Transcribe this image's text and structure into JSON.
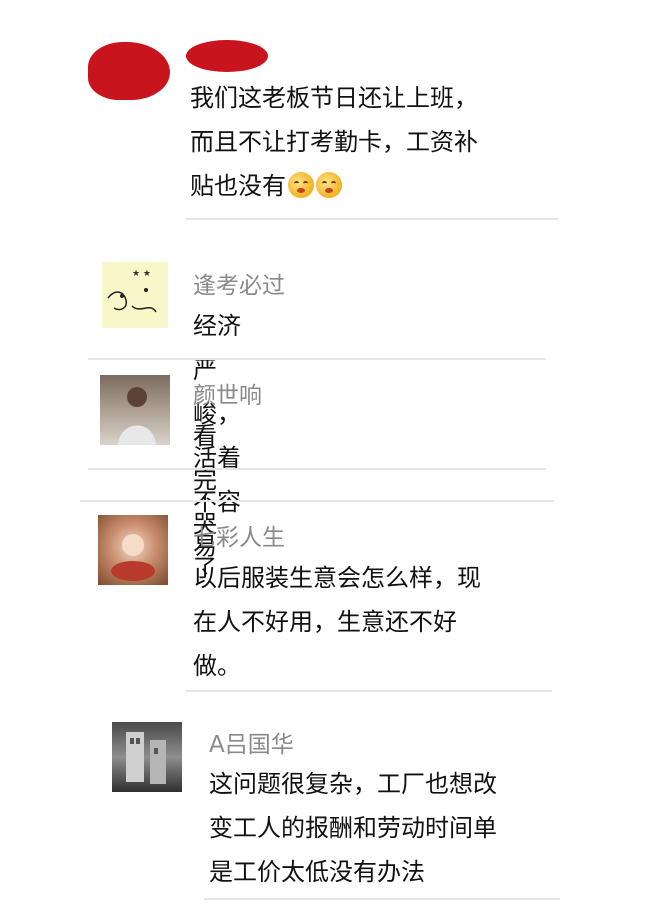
{
  "comments": [
    {
      "name": "",
      "avatar": "redacted-avatar",
      "lines": [
        "我们这老板节日还让上班，",
        "而且不让打考勤卡，工资补",
        "贴也没有"
      ],
      "emojis": [
        "crying-face-emoji",
        "crying-face-emoji"
      ]
    },
    {
      "name": "逢考必过",
      "avatar": "cartoon-sticker-avatar",
      "lines": [
        "经济严峻，活着不容易"
      ]
    },
    {
      "name": "颜世响",
      "avatar": "person-photo-avatar",
      "lines": [
        "看完哭了"
      ]
    },
    {
      "name": "七彩人生",
      "avatar": "baby-photo-avatar",
      "lines": [
        "以后服装生意会怎么样，现",
        "在人不好用，生意还不好",
        "做。"
      ]
    },
    {
      "name": "A吕国华",
      "avatar": "building-photo-avatar",
      "lines": [
        "这问题很复杂，工厂也想改",
        "变工人的报酬和劳动时间单",
        "是工价太低没有办法"
      ]
    }
  ],
  "colors": {
    "name": "#8a8a8a",
    "text": "#111111",
    "redaction": "#c8141c",
    "divider": "#e6e6e6"
  }
}
